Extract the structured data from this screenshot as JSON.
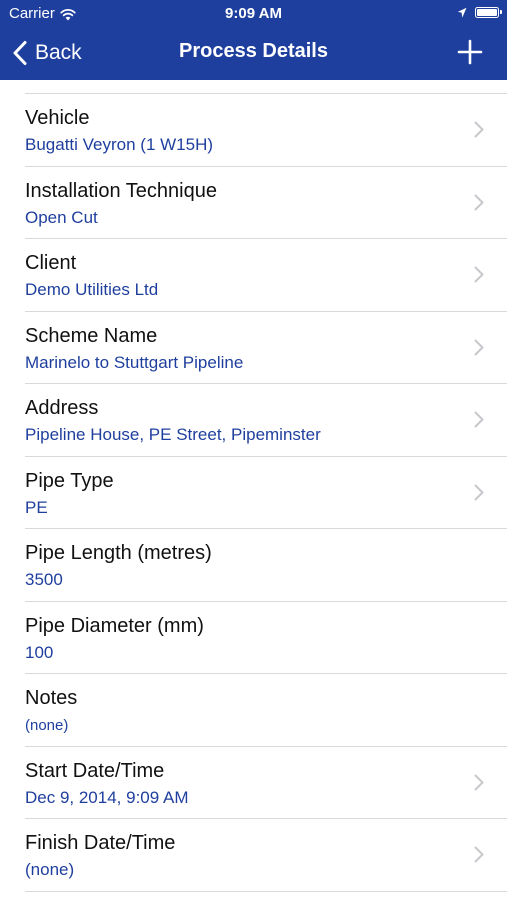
{
  "status_bar": {
    "carrier": "Carrier",
    "time": "9:09 AM"
  },
  "nav": {
    "back_label": "Back",
    "title": "Process Details"
  },
  "rows": [
    {
      "label": "Vehicle",
      "value": "Bugatti Veyron (1 W15H)",
      "disclosure": true
    },
    {
      "label": "Installation Technique",
      "value": "Open Cut",
      "disclosure": true
    },
    {
      "label": "Client",
      "value": "Demo Utilities Ltd",
      "disclosure": true
    },
    {
      "label": "Scheme Name",
      "value": "Marinelo to Stuttgart Pipeline",
      "disclosure": true
    },
    {
      "label": "Address",
      "value": "Pipeline House, PE Street, Pipeminster",
      "disclosure": true
    },
    {
      "label": "Pipe Type",
      "value": "PE",
      "disclosure": true
    },
    {
      "label": "Pipe Length (metres)",
      "value": "3500",
      "disclosure": false
    },
    {
      "label": "Pipe Diameter (mm)",
      "value": "100",
      "disclosure": false
    },
    {
      "label": "Notes",
      "value": "(none)",
      "disclosure": false
    },
    {
      "label": "Start Date/Time",
      "value": "Dec 9, 2014, 9:09 AM",
      "disclosure": true
    },
    {
      "label": "Finish Date/Time",
      "value": "(none)",
      "disclosure": true
    }
  ],
  "colors": {
    "nav_background": "#1f3f9e",
    "value_text": "#1f3f9e",
    "separator": "#d9d9dc",
    "disclosure": "#c7c7cc"
  },
  "icons": {
    "wifi": "wifi-icon",
    "location": "location-arrow-icon",
    "battery": "battery-icon",
    "back": "chevron-left-icon",
    "add": "plus-icon",
    "disclosure": "chevron-right-icon"
  }
}
